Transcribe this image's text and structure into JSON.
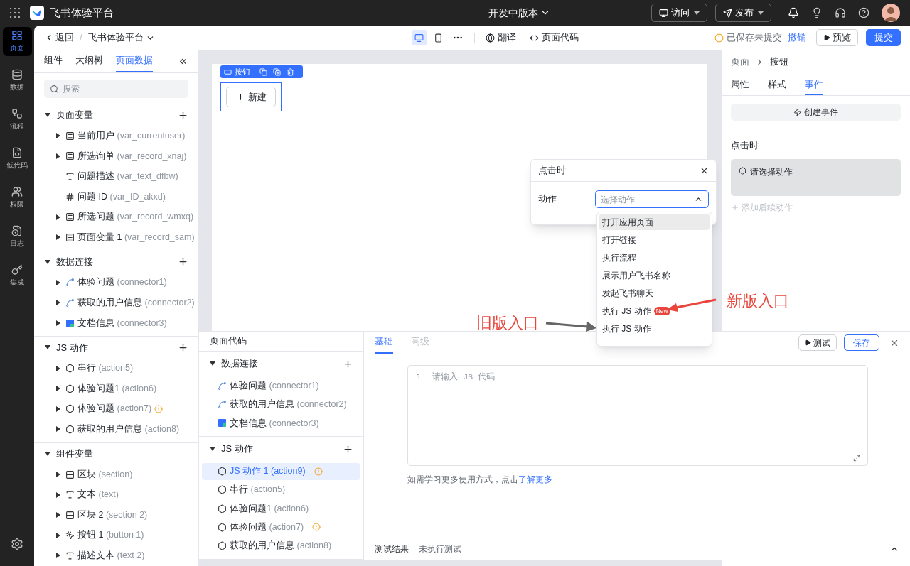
{
  "topbar": {
    "app_name": "飞书体验平台",
    "version": "开发中版本",
    "buttons": [
      {
        "kind": "visit",
        "label": "访问"
      },
      {
        "kind": "publish",
        "label": "发布"
      }
    ]
  },
  "rail": [
    {
      "kind": "page",
      "label": "页面",
      "selected": true
    },
    {
      "kind": "data",
      "label": "数据",
      "selected": false
    },
    {
      "kind": "flow",
      "label": "流程",
      "selected": false
    },
    {
      "kind": "code",
      "label": "低代码",
      "selected": false
    },
    {
      "kind": "perm",
      "label": "权限",
      "selected": false
    },
    {
      "kind": "log",
      "label": "日志",
      "selected": false
    },
    {
      "kind": "integ",
      "label": "集成",
      "selected": false
    }
  ],
  "toolbar": {
    "back": "返回",
    "separator": "/",
    "breadcrumb": "飞书体验平台",
    "devices": [
      {
        "kind": "desktop",
        "selected": true
      },
      {
        "kind": "mobile",
        "selected": false
      }
    ],
    "translate": "翻译",
    "page_code": "页面代码",
    "status": "已保存未提交",
    "undo": "撤销",
    "preview": "预览",
    "submit": "提交"
  },
  "left_panel": {
    "tabs": [
      {
        "label": "组件",
        "selected": false
      },
      {
        "label": "大纲树",
        "selected": false
      },
      {
        "label": "页面数据",
        "selected": true
      }
    ],
    "search_placeholder": "搜索",
    "sections": [
      {
        "title": "页面变量",
        "expanded": true,
        "addable": true,
        "items": [
          {
            "kind": "record",
            "name": "当前用户",
            "id": "(var_currentuser)",
            "expandable": true,
            "warning": false
          },
          {
            "kind": "record",
            "name": "所选询单",
            "id": "(var_record_xnaj)",
            "expandable": true,
            "warning": false
          },
          {
            "kind": "text",
            "name": "问题描述",
            "id": "(var_text_dfbw)",
            "expandable": false,
            "warning": false
          },
          {
            "kind": "number",
            "name": "问题 ID",
            "id": "(var_ID_akxd)",
            "expandable": false,
            "warning": false
          },
          {
            "kind": "record",
            "name": "所选问题",
            "id": "(var_record_wmxq)",
            "expandable": true,
            "warning": false
          },
          {
            "kind": "record",
            "name": "页面变量 1",
            "id": "(var_record_sam)",
            "expandable": true,
            "warning": false
          }
        ]
      },
      {
        "title": "数据连接",
        "expanded": true,
        "addable": true,
        "items": [
          {
            "kind": "connector",
            "name": "体验问题",
            "id": "(connector1)",
            "expandable": true,
            "warning": false
          },
          {
            "kind": "connector",
            "name": "获取的用户信息",
            "id": "(connector2)",
            "expandable": true,
            "warning": false
          },
          {
            "kind": "doc",
            "name": "文档信息",
            "id": "(connector3)",
            "expandable": true,
            "warning": false
          }
        ]
      },
      {
        "title": "JS 动作",
        "expanded": true,
        "addable": true,
        "items": [
          {
            "kind": "action",
            "name": "串行",
            "id": "(action5)",
            "expandable": true,
            "warning": false
          },
          {
            "kind": "action",
            "name": "体验问题1",
            "id": "(action6)",
            "expandable": true,
            "warning": false
          },
          {
            "kind": "action",
            "name": "体验问题",
            "id": "(action7)",
            "expandable": true,
            "warning": true
          },
          {
            "kind": "action",
            "name": "获取的用户信息",
            "id": "(action8)",
            "expandable": true,
            "warning": false
          }
        ]
      },
      {
        "title": "组件变量",
        "expanded": true,
        "addable": false,
        "items": [
          {
            "kind": "section",
            "name": "区块",
            "id": "(section)",
            "expandable": true,
            "warning": false
          },
          {
            "kind": "text",
            "name": "文本",
            "id": "(text)",
            "expandable": true,
            "warning": false
          },
          {
            "kind": "section",
            "name": "区块 2",
            "id": "(section 2)",
            "expandable": true,
            "warning": false
          },
          {
            "kind": "button",
            "name": "按钮 1",
            "id": "(button 1)",
            "expandable": true,
            "warning": false
          },
          {
            "kind": "text",
            "name": "描述文本",
            "id": "(text 2)",
            "expandable": true,
            "warning": false
          }
        ]
      }
    ]
  },
  "canvas": {
    "toolbar_label": "按钮",
    "button": "新建"
  },
  "right_panel": {
    "breadcrumb": [
      "页面",
      "按钮"
    ],
    "tabs": [
      {
        "label": "属性",
        "selected": false
      },
      {
        "label": "样式",
        "selected": false
      },
      {
        "label": "事件",
        "selected": true
      }
    ],
    "create_event": "创建事件",
    "event_title": "点击时",
    "action_placeholder": "请选择动作",
    "add_next": "添加后续动作"
  },
  "popup": {
    "title": "点击时",
    "field_label": "动作",
    "placeholder": "选择动作",
    "options": [
      {
        "label": "打开应用页面",
        "selected": true
      },
      {
        "label": "打开链接",
        "selected": false
      },
      {
        "label": "执行流程",
        "selected": false
      },
      {
        "label": "展示用户飞书名称",
        "selected": false
      },
      {
        "label": "发起飞书聊天",
        "selected": false
      },
      {
        "label": "执行 JS 动作",
        "selected": false,
        "badge": "New"
      },
      {
        "label": "执行 JS 动作",
        "selected": false
      }
    ]
  },
  "code_panel": {
    "title": "页面代码",
    "sections": [
      {
        "title": "数据连接",
        "items": [
          {
            "kind": "connector",
            "name": "体验问题",
            "id": "(connector1)",
            "selected": false,
            "warning": false
          },
          {
            "kind": "connector",
            "name": "获取的用户信息",
            "id": "(connector2)",
            "selected": false,
            "warning": false
          },
          {
            "kind": "doc",
            "name": "文档信息",
            "id": "(connector3)",
            "selected": false,
            "warning": false
          }
        ]
      },
      {
        "title": "JS 动作",
        "items": [
          {
            "kind": "action",
            "name": "JS 动作 1",
            "id": "(action9)",
            "selected": true,
            "warning": true
          },
          {
            "kind": "action",
            "name": "串行",
            "id": "(action5)",
            "selected": false,
            "warning": false
          },
          {
            "kind": "action",
            "name": "体验问题1",
            "id": "(action6)",
            "selected": false,
            "warning": false
          },
          {
            "kind": "action",
            "name": "体验问题",
            "id": "(action7)",
            "selected": false,
            "warning": true
          },
          {
            "kind": "action",
            "name": "获取的用户信息",
            "id": "(action8)",
            "selected": false,
            "warning": false
          }
        ]
      }
    ],
    "tabs": [
      {
        "label": "基础",
        "selected": true
      },
      {
        "label": "高级",
        "selected": false
      }
    ],
    "test": "测试",
    "save": "保存",
    "line_number": "1",
    "placeholder": "请输入 JS 代码",
    "help": "如需学习更多使用方式，点击",
    "help_link": "了解更多",
    "result_label": "测试结果",
    "result": "未执行测试"
  },
  "annotations": [
    {
      "kind": "new",
      "text": "新版入口"
    },
    {
      "kind": "old",
      "text": "旧版入口"
    }
  ]
}
